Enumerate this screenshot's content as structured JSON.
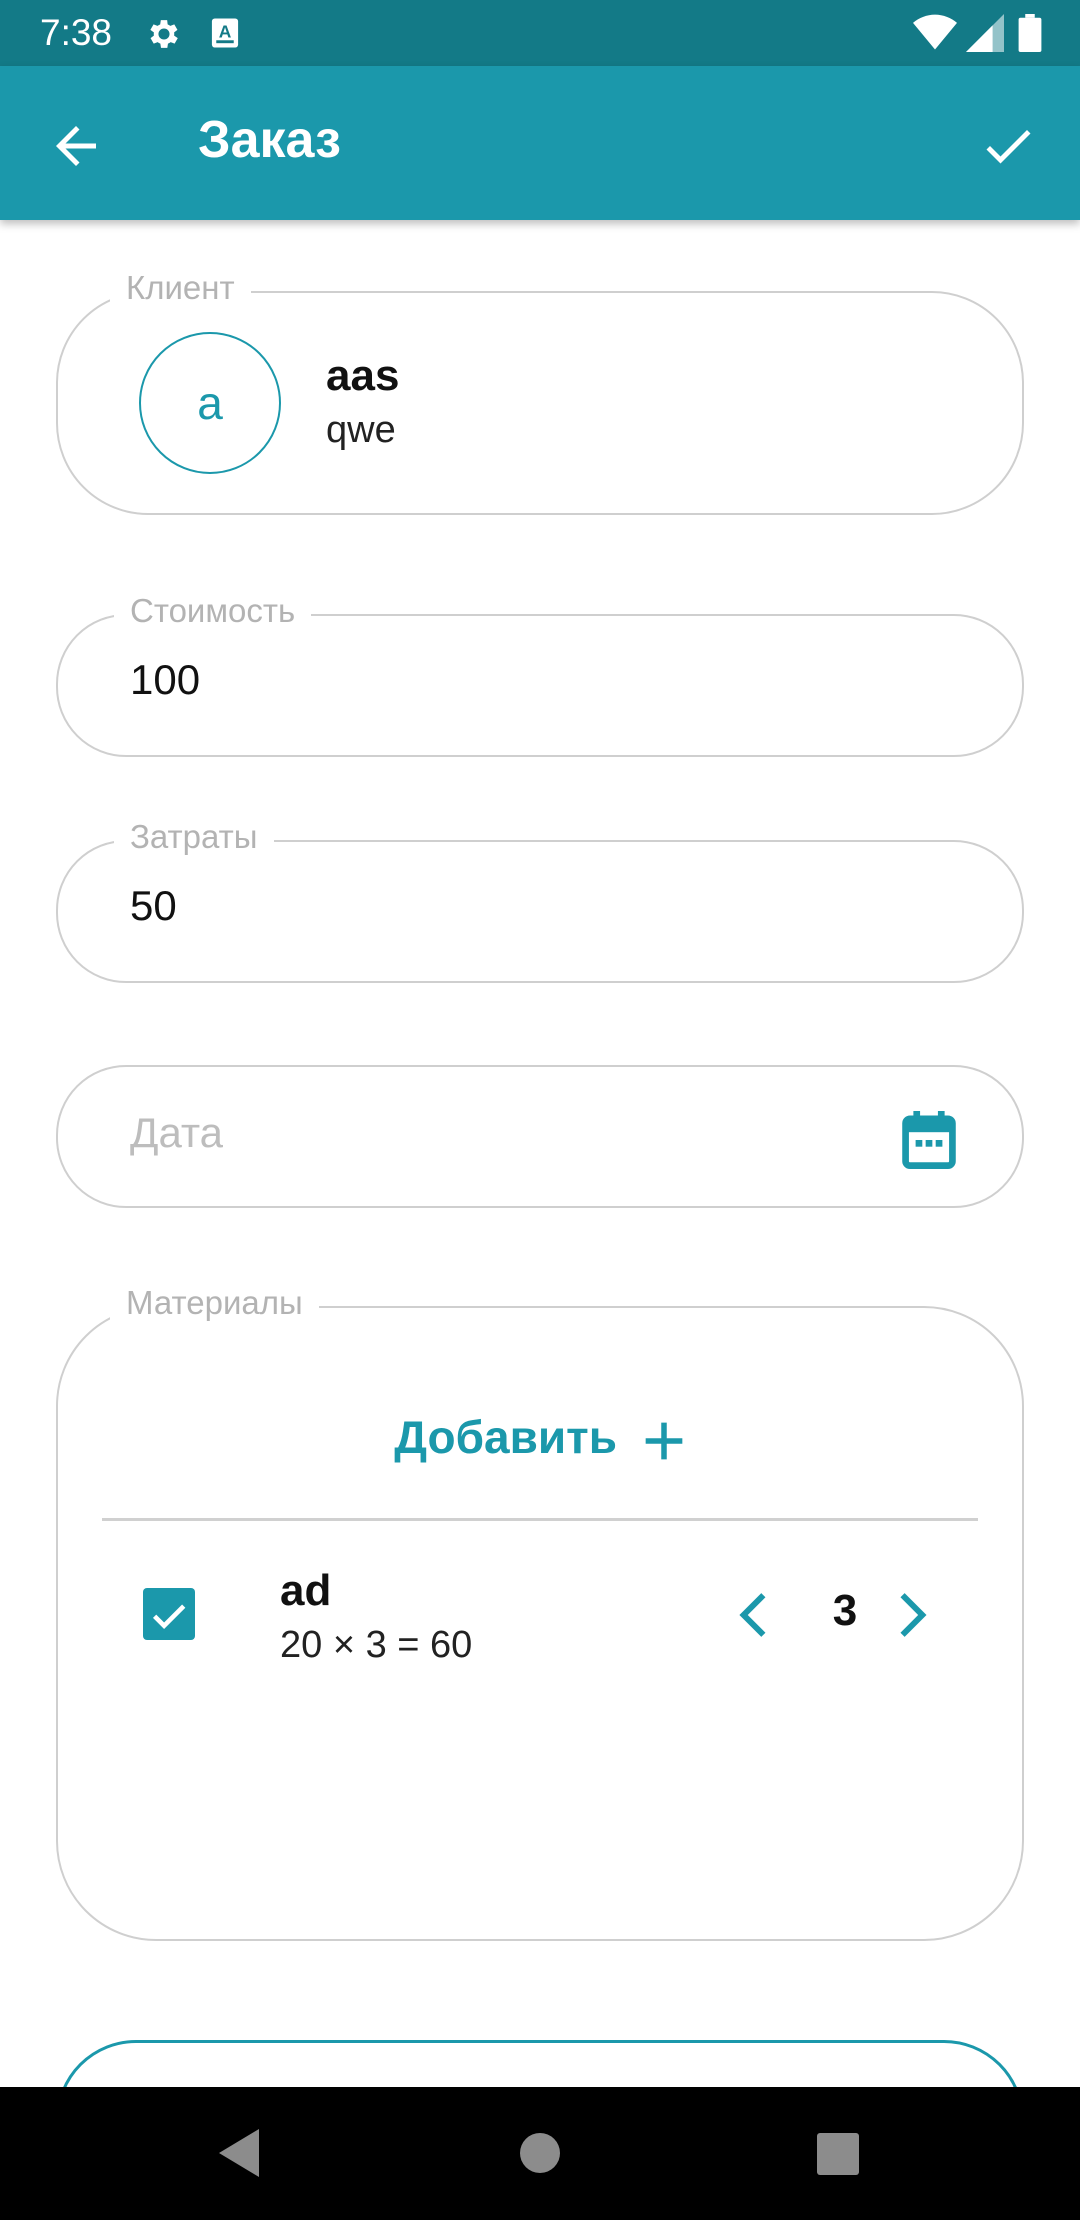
{
  "status_bar": {
    "time": "7:38"
  },
  "app_bar": {
    "title": "Заказ"
  },
  "client": {
    "label": "Клиент",
    "avatar_letter": "a",
    "name": "aas",
    "subtitle": "qwe"
  },
  "cost": {
    "label": "Стоимость",
    "value": "100"
  },
  "expenses": {
    "label": "Затраты",
    "value": "50"
  },
  "date": {
    "placeholder": "Дата"
  },
  "materials": {
    "label": "Материалы",
    "add_label": "Добавить",
    "items": [
      {
        "name": "ad",
        "calc": "20 × 3 = 60",
        "quantity": "3",
        "checked": true
      }
    ]
  },
  "colors": {
    "accent": "#1b98ab",
    "status_bar": "#137a87",
    "outline": "#cfcfcf"
  },
  "icons": [
    "gear-icon",
    "keyboard-a-icon",
    "wifi-icon",
    "signal-icon",
    "battery-icon",
    "back-arrow-icon",
    "check-icon",
    "calendar-icon",
    "plus-icon",
    "checkbox-checked-icon",
    "chevron-left-icon",
    "chevron-right-icon"
  ]
}
